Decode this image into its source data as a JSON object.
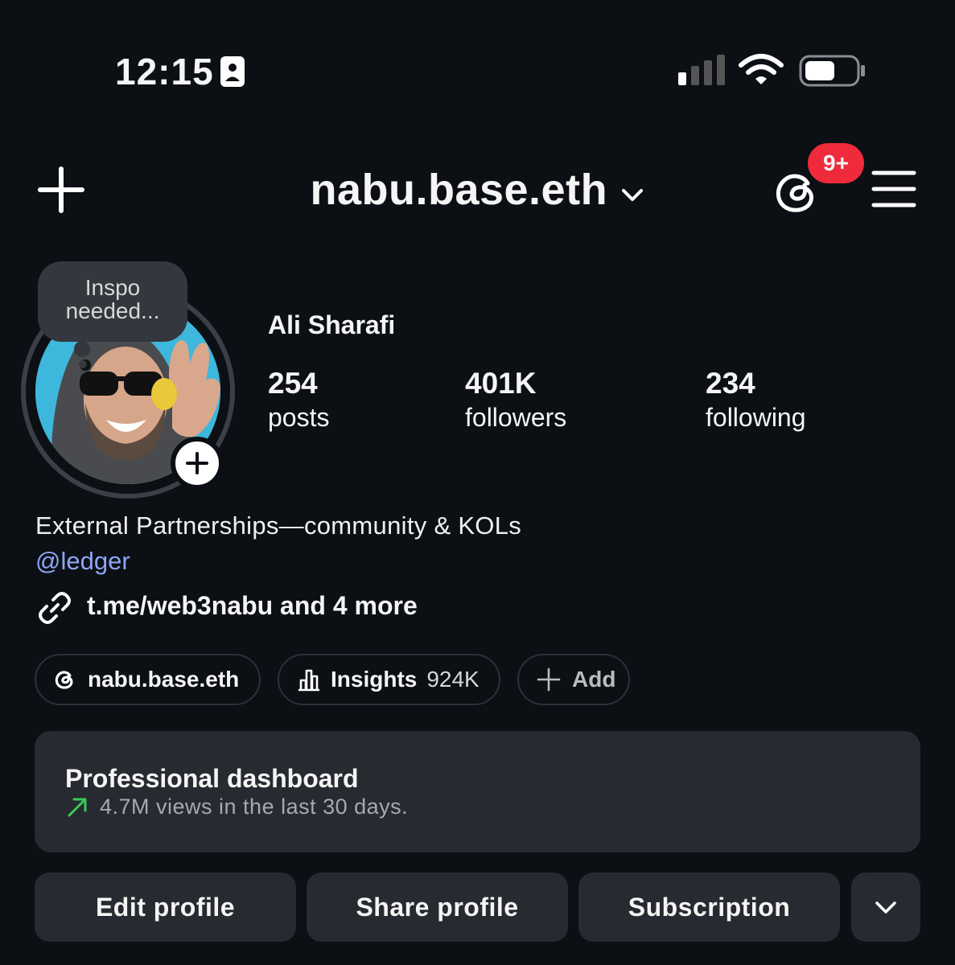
{
  "status_bar": {
    "time": "12:15"
  },
  "header": {
    "username": "nabu.base.eth",
    "threads_badge": "9+"
  },
  "profile": {
    "note": [
      "Inspo",
      "needed..."
    ],
    "full_name": "Ali Sharafi",
    "stats": [
      {
        "value": "254",
        "label": "posts"
      },
      {
        "value": "401K",
        "label": "followers"
      },
      {
        "value": "234",
        "label": "following"
      }
    ],
    "bio": "External Partnerships—community & KOLs",
    "mention": "@ledger",
    "link": "t.me/web3nabu and 4 more"
  },
  "chips": {
    "threads_label": "nabu.base.eth",
    "insights_label": "Insights",
    "insights_value": "924K",
    "add_label": "Add"
  },
  "dashboard": {
    "title": "Professional dashboard",
    "subtitle": "4.7M views in the last 30 days.",
    "trend_color": "#3cc85a"
  },
  "actions": {
    "edit": "Edit profile",
    "share": "Share profile",
    "subscription": "Subscription"
  },
  "colors": {
    "badge": "#ef2b3b",
    "mention": "#8da6f5"
  }
}
